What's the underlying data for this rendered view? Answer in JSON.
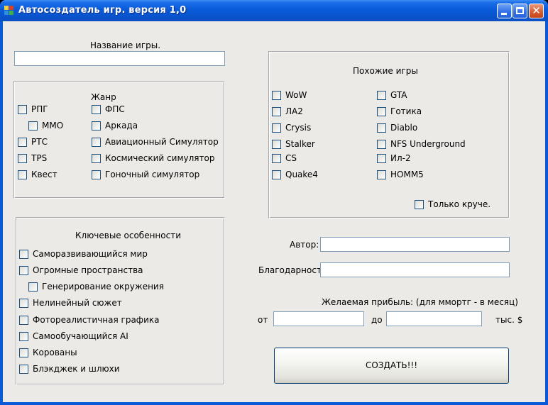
{
  "window": {
    "title": "Автосоздатель игр. версия 1,0",
    "title_bar_color": "#0a5ad8",
    "controls": {
      "minimize": "minimize-icon",
      "maximize": "maximize-icon",
      "close": "close-icon"
    }
  },
  "game_name": {
    "label": "Название игры.",
    "value": ""
  },
  "genre": {
    "title": "Жанр",
    "left": [
      "РПГ",
      "ММО",
      "РТС",
      "TPS",
      "Квест"
    ],
    "right": [
      "ФПС",
      "Аркада",
      "Авиационный Симулятор",
      "Космический симулятор",
      "Гоночный симулятор"
    ]
  },
  "features": {
    "title": "Ключевые особенности",
    "items": [
      "Саморазвивающийся мир",
      "Огромные пространства",
      "Генерирование окружения",
      "Нелинейный сюжет",
      "Фотореалистичная графика",
      "Самообучающийся AI",
      "Корованы",
      "Блэкджек и шлюхи"
    ]
  },
  "similar_games": {
    "title": "Похожие игры",
    "left": [
      "WoW",
      "ЛА2",
      "Crysis",
      "Stalker",
      "CS",
      "Quake4"
    ],
    "right": [
      "GTA",
      "Готика",
      "Diablo",
      "NFS Underground",
      "Ил-2",
      "HOMM5"
    ],
    "only_better": "Только круче."
  },
  "author": {
    "label": "Автор:",
    "value": ""
  },
  "thanks": {
    "label": "Благодарности",
    "value": ""
  },
  "profit": {
    "title": "Желаемая прибыль: (для ммортг - в месяц)",
    "from_label": "от",
    "to_label": "до",
    "unit": "тыс. $",
    "from_value": "",
    "to_value": ""
  },
  "create_button": "СОЗДАТЬ!!!"
}
